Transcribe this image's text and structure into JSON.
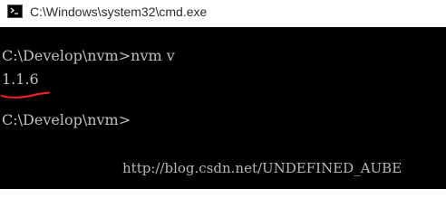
{
  "window": {
    "title": "C:\\Windows\\system32\\cmd.exe",
    "icon": "cmd-console-icon"
  },
  "console": {
    "lines": [
      "C:\\Develop\\nvm>nvm v",
      "1.1.6",
      "C:\\Develop\\nvm>"
    ],
    "annotation": "red-handwritten-underline",
    "annotation_color": "#e8202a",
    "text_color": "#c0c0c0",
    "background_color": "#000000"
  },
  "watermark": {
    "text": "http://blog.csdn.net/UNDEFINED_AUBE"
  }
}
